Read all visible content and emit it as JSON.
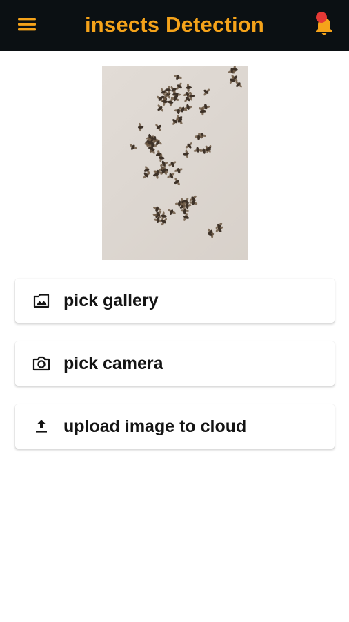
{
  "appbar": {
    "title": "insects Detection",
    "menu_icon": "menu-icon",
    "notification_icon": "bell-icon",
    "accent_color": "#f5a31a",
    "badge_color": "#e53935",
    "background_color": "#0b1013"
  },
  "preview": {
    "image": "photo of many small winged insects on a white wall"
  },
  "actions": [
    {
      "label": "pick gallery",
      "icon": "image-icon"
    },
    {
      "label": "pick camera",
      "icon": "camera-icon"
    },
    {
      "label": "upload image to cloud",
      "icon": "upload-icon"
    }
  ]
}
